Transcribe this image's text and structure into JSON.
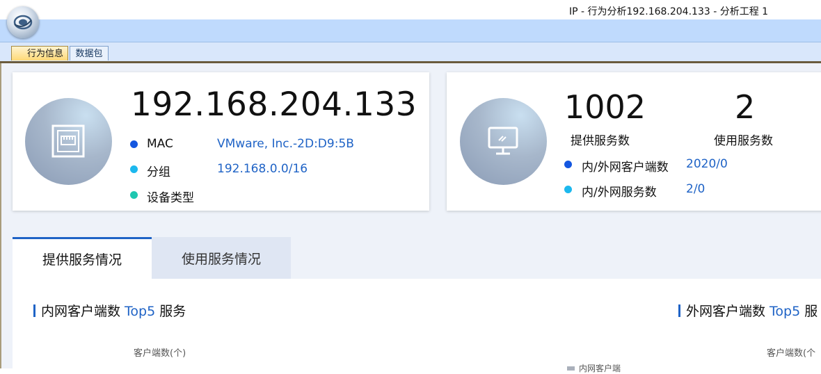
{
  "window": {
    "title": "IP - 行为分析192.168.204.133 - 分析工程 1"
  },
  "tabs": [
    {
      "label": "行为信息",
      "active": true
    },
    {
      "label": "数据包",
      "active": false
    }
  ],
  "host": {
    "ip": "192.168.204.133",
    "rows": [
      {
        "label": "MAC",
        "value": "VMware, Inc.-2D:D9:5B",
        "dot_color": "#1457e0"
      },
      {
        "label": "分组",
        "value": "192.168.0.0/16",
        "dot_color": "#1cb8ee"
      },
      {
        "label": "设备类型",
        "value": "",
        "dot_color": "#1fc7b0"
      }
    ]
  },
  "service_stats": {
    "provided": {
      "value": "1002",
      "label": "提供服务数"
    },
    "used": {
      "value": "2",
      "label": "使用服务数"
    },
    "rows": [
      {
        "label": "内/外网客户端数",
        "value": "2020/0",
        "dot_color": "#1457e0"
      },
      {
        "label": "内/外网服务数",
        "value": "2/0",
        "dot_color": "#1cb8ee"
      }
    ]
  },
  "service_tabs": [
    {
      "label": "提供服务情况",
      "active": true
    },
    {
      "label": "使用服务情况",
      "active": false
    }
  ],
  "sections": [
    {
      "prefix": "内网客户端数 ",
      "highlight": "Top5",
      "suffix": " 服务",
      "axis_label": "客户端数(个)"
    },
    {
      "prefix": "外网客户端数 ",
      "highlight": "Top5",
      "suffix": " 服",
      "axis_label": "客户端数(个"
    }
  ],
  "legend": {
    "label": "内网客户端"
  },
  "colors": {
    "accent": "#1f63c6",
    "ribbon": "#bfdafd"
  }
}
